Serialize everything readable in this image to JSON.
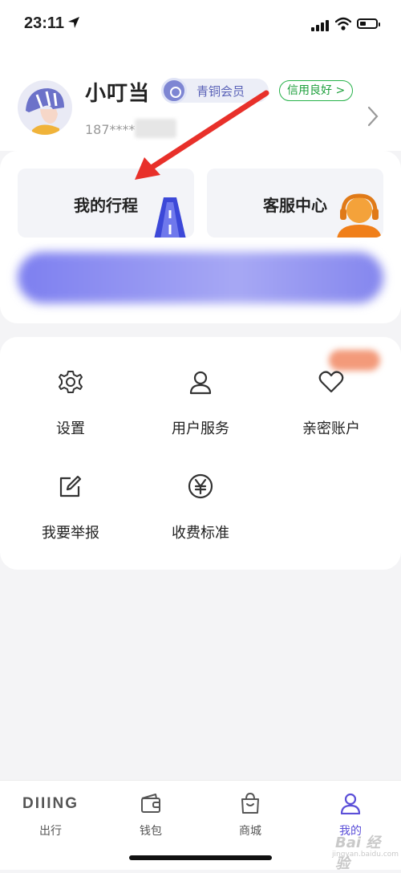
{
  "status": {
    "time": "23:11"
  },
  "profile": {
    "username": "小叮当",
    "member_level": "青铜会员",
    "credit_status": "信用良好 >",
    "phone": "187****"
  },
  "quick_actions": [
    {
      "label": "我的行程"
    },
    {
      "label": "客服中心"
    }
  ],
  "services": [
    {
      "label": "设置",
      "icon": "gear-icon"
    },
    {
      "label": "用户服务",
      "icon": "user-icon"
    },
    {
      "label": "亲密账户",
      "icon": "heart-icon"
    },
    {
      "label": "我要举报",
      "icon": "edit-icon"
    },
    {
      "label": "收费标准",
      "icon": "yen-icon"
    }
  ],
  "tabs": [
    {
      "label": "出行",
      "logo": "DIIING"
    },
    {
      "label": "钱包",
      "icon": "wallet-icon"
    },
    {
      "label": "商城",
      "icon": "shopping-bag-icon"
    },
    {
      "label": "我的",
      "icon": "person-icon",
      "active": true
    }
  ],
  "watermark": {
    "brand": "Bai 经验",
    "url": "jingyan.baidu.com"
  },
  "colors": {
    "accent": "#5b4fd8",
    "credit_green": "#1fa03d",
    "member_blue": "#5b63b8",
    "annotation_red": "#e8302a"
  }
}
